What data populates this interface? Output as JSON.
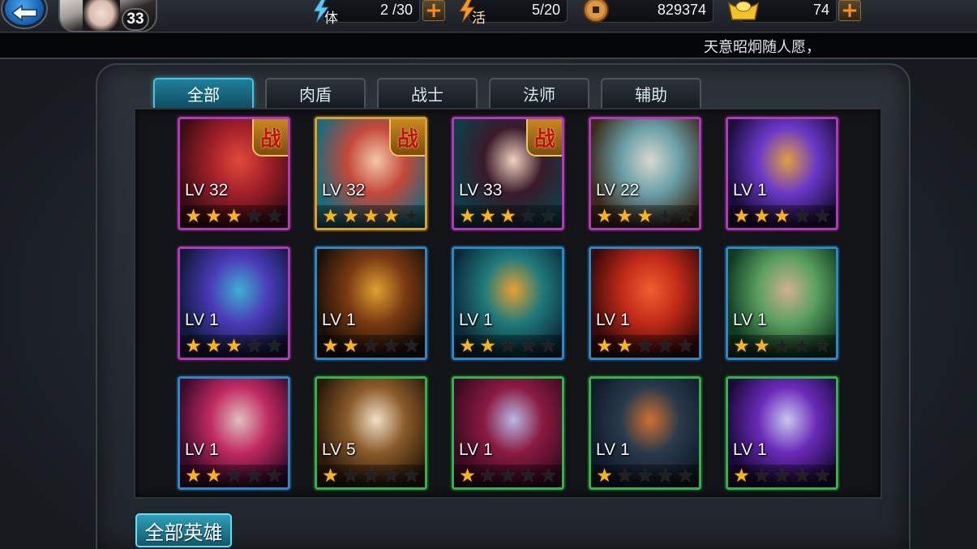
{
  "header": {
    "player_level": "33",
    "stamina": {
      "label": "体",
      "value": "2 /30"
    },
    "activity": {
      "label": "活",
      "value": "5/20"
    },
    "copper": {
      "value": "829374"
    },
    "ingot": {
      "value": "74"
    }
  },
  "announcement": "天意昭炯随人愿，",
  "tabs": [
    {
      "label": "全部",
      "active": true
    },
    {
      "label": "肉盾",
      "active": false
    },
    {
      "label": "战士",
      "active": false
    },
    {
      "label": "法师",
      "active": false
    },
    {
      "label": "辅助",
      "active": false
    }
  ],
  "battle_badge": "战",
  "heroes": [
    {
      "level": "LV 32",
      "stars": 3,
      "frame": "purple",
      "in_battle": true,
      "colors": [
        "#3a0d14",
        "#a3202a",
        "#e14a3a"
      ]
    },
    {
      "level": "LV 32",
      "stars": 4,
      "frame": "gold",
      "in_battle": true,
      "colors": [
        "#1f6a7a",
        "#c4483a",
        "#f2c9a8"
      ]
    },
    {
      "level": "LV 33",
      "stars": 3,
      "frame": "purple",
      "in_battle": true,
      "colors": [
        "#0e3d45",
        "#3a1a2a",
        "#f0d2c0"
      ]
    },
    {
      "level": "LV 22",
      "stars": 3,
      "frame": "purple",
      "in_battle": false,
      "colors": [
        "#3a2a1a",
        "#6aa0a8",
        "#d8d8d0"
      ]
    },
    {
      "level": "LV 1",
      "stars": 3,
      "frame": "purple",
      "in_battle": false,
      "colors": [
        "#1a0d3a",
        "#6a38c8",
        "#e0a040"
      ]
    },
    {
      "level": "LV 1",
      "stars": 3,
      "frame": "purple",
      "in_battle": false,
      "colors": [
        "#101a3a",
        "#4a3ab8",
        "#3fb0d0"
      ]
    },
    {
      "level": "LV 1",
      "stars": 2,
      "frame": "blue",
      "in_battle": false,
      "colors": [
        "#1a1008",
        "#7a3a12",
        "#e0a030"
      ]
    },
    {
      "level": "LV 1",
      "stars": 2,
      "frame": "blue",
      "in_battle": false,
      "colors": [
        "#0a2a3a",
        "#1f7a7a",
        "#e8a032"
      ]
    },
    {
      "level": "LV 1",
      "stars": 2,
      "frame": "blue",
      "in_battle": false,
      "colors": [
        "#3a0a08",
        "#c02a18",
        "#f06030"
      ]
    },
    {
      "level": "LV 1",
      "stars": 2,
      "frame": "blue",
      "in_battle": false,
      "colors": [
        "#0f3a20",
        "#5aa060",
        "#d0b090"
      ]
    },
    {
      "level": "LV 1",
      "stars": 2,
      "frame": "blue",
      "in_battle": false,
      "colors": [
        "#3a0a2a",
        "#c02a60",
        "#e0c0c0"
      ]
    },
    {
      "level": "LV 5",
      "stars": 1,
      "frame": "green",
      "in_battle": false,
      "colors": [
        "#2a1a0a",
        "#8a5a2a",
        "#f0e0c8"
      ]
    },
    {
      "level": "LV 1",
      "stars": 1,
      "frame": "green",
      "in_battle": false,
      "colors": [
        "#3a0a20",
        "#8a1a40",
        "#b8b8e8"
      ]
    },
    {
      "level": "LV 1",
      "stars": 1,
      "frame": "green",
      "in_battle": false,
      "colors": [
        "#0f1a2a",
        "#2a3a4a",
        "#d07030"
      ]
    },
    {
      "level": "LV 1",
      "stars": 1,
      "frame": "green",
      "in_battle": false,
      "colors": [
        "#1a0a3a",
        "#6a2ab8",
        "#c8c8f0"
      ]
    }
  ],
  "max_stars": 5,
  "all_heroes_button": "全部英雄"
}
